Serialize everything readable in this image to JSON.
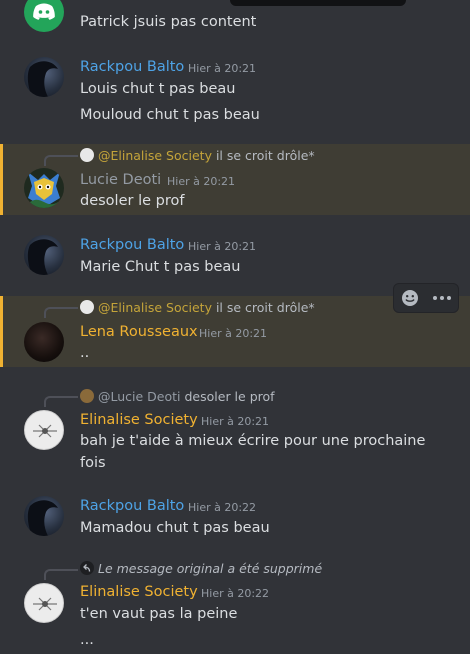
{
  "messages": {
    "m1": {
      "line1": "Patrick jsuis pas content"
    },
    "m2": {
      "username": "Rackpou Balto",
      "time": "Hier à 20:21",
      "line1": "Louis chut t pas beau",
      "line2": "Mouloud chut t pas beau"
    },
    "m3": {
      "reply_name": "@Elinalise Society",
      "reply_text": "il se croit drôle*",
      "username": "Lucie Deoti",
      "time": "Hier à 20:21",
      "line1": "desoler le prof"
    },
    "m4": {
      "username": "Rackpou Balto",
      "time": "Hier à 20:21",
      "line1": "Marie Chut t pas beau"
    },
    "m5": {
      "reply_name": "@Elinalise Society",
      "reply_text": "il se croit drôle*",
      "username": "Lena Rousseaux",
      "time": "Hier à 20:21",
      "line1": ".."
    },
    "m6": {
      "reply_name": "@Lucie Deoti",
      "reply_text": "desoler le prof",
      "username": "Elinalise Society",
      "time": "Hier à 20:21",
      "line1": "bah je t'aide à mieux écrire pour une prochaine",
      "line2": "fois"
    },
    "m7": {
      "username": "Rackpou Balto",
      "time": "Hier à 20:22",
      "line1": "Mamadou chut t pas beau"
    },
    "m8": {
      "reply_text": "Le message original a été supprimé",
      "username": "Elinalise Society",
      "time": "Hier à 20:22",
      "line1": "t'en vaut pas la peine",
      "line2": "..."
    }
  },
  "colors": {
    "rackpou": "#4ea3e6",
    "lucie": "#949ba4",
    "lena": "#f0b232",
    "elinalise": "#f0b232",
    "mention_bg": "#3f3d34",
    "mention_bar": "#f0b232"
  },
  "icons": {
    "discord": "discord-logo-icon",
    "reply": "reply-arrow-icon",
    "emoji": "emoji-reaction-icon",
    "more": "more-options-icon"
  }
}
